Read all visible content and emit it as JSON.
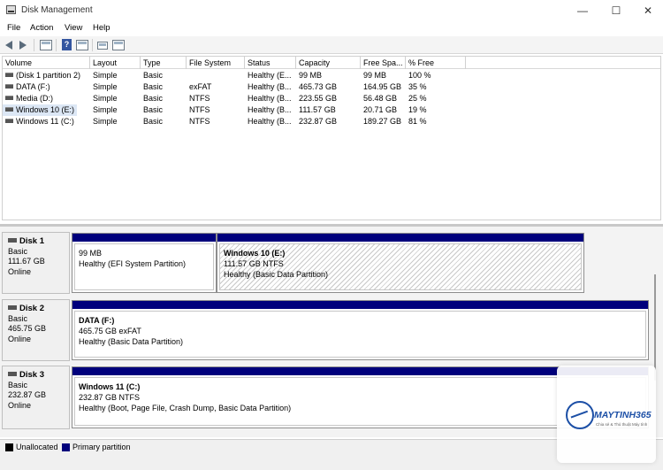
{
  "window": {
    "title": "Disk Management",
    "controls": {
      "minimize": "—",
      "maximize": "☐",
      "close": "✕"
    }
  },
  "menu": [
    "File",
    "Action",
    "View",
    "Help"
  ],
  "toolbar": {
    "icons": [
      "back-arrow-icon",
      "forward-arrow-icon",
      "show-hide-console-tree-icon",
      "help-icon",
      "properties-icon",
      "connect-icon",
      "console-icon"
    ],
    "help_glyph": "?"
  },
  "volume_list": {
    "columns": [
      "Volume",
      "Layout",
      "Type",
      "File System",
      "Status",
      "Capacity",
      "Free Spa...",
      "% Free"
    ],
    "rows": [
      [
        "(Disk 1 partition 2)",
        "Simple",
        "Basic",
        "",
        "Healthy (E...",
        "99 MB",
        "99 MB",
        "100 %"
      ],
      [
        "DATA (F:)",
        "Simple",
        "Basic",
        "exFAT",
        "Healthy (B...",
        "465.73 GB",
        "164.95 GB",
        "35 %"
      ],
      [
        "Media (D:)",
        "Simple",
        "Basic",
        "NTFS",
        "Healthy (B...",
        "223.55 GB",
        "56.48 GB",
        "25 %"
      ],
      [
        "Windows 10 (E:)",
        "Simple",
        "Basic",
        "NTFS",
        "Healthy (B...",
        "111.57 GB",
        "20.71 GB",
        "19 %"
      ],
      [
        "Windows 11 (C:)",
        "Simple",
        "Basic",
        "NTFS",
        "Healthy (B...",
        "232.87 GB",
        "189.27 GB",
        "81 %"
      ]
    ],
    "selected_row": 3
  },
  "disks": [
    {
      "name": "Disk 1",
      "type": "Basic",
      "size": "111.67 GB",
      "status": "Online",
      "partitions": [
        {
          "title": "",
          "line1": "99 MB",
          "line2": "Healthy (EFI System Partition)",
          "hatched": false
        },
        {
          "title": "Windows 10  (E:)",
          "line1": "111.57 GB NTFS",
          "line2": "Healthy (Basic Data Partition)",
          "hatched": true
        }
      ]
    },
    {
      "name": "Disk 2",
      "type": "Basic",
      "size": "465.75 GB",
      "status": "Online",
      "partitions": [
        {
          "title": "DATA  (F:)",
          "line1": "465.75 GB exFAT",
          "line2": "Healthy (Basic Data Partition)",
          "hatched": false
        }
      ]
    },
    {
      "name": "Disk 3",
      "type": "Basic",
      "size": "232.87 GB",
      "status": "Online",
      "partitions": [
        {
          "title": "Windows 11  (C:)",
          "line1": "232.87 GB NTFS",
          "line2": "Healthy (Boot, Page File, Crash Dump, Basic Data Partition)",
          "hatched": false
        }
      ]
    }
  ],
  "legend": [
    {
      "label": "Unallocated",
      "color": "#000000"
    },
    {
      "label": "Primary partition",
      "color": "#00007c"
    }
  ],
  "watermark": {
    "brand": "MAYTINH365",
    "tagline": "Chia sẻ & Thủ thuật Máy tính"
  }
}
